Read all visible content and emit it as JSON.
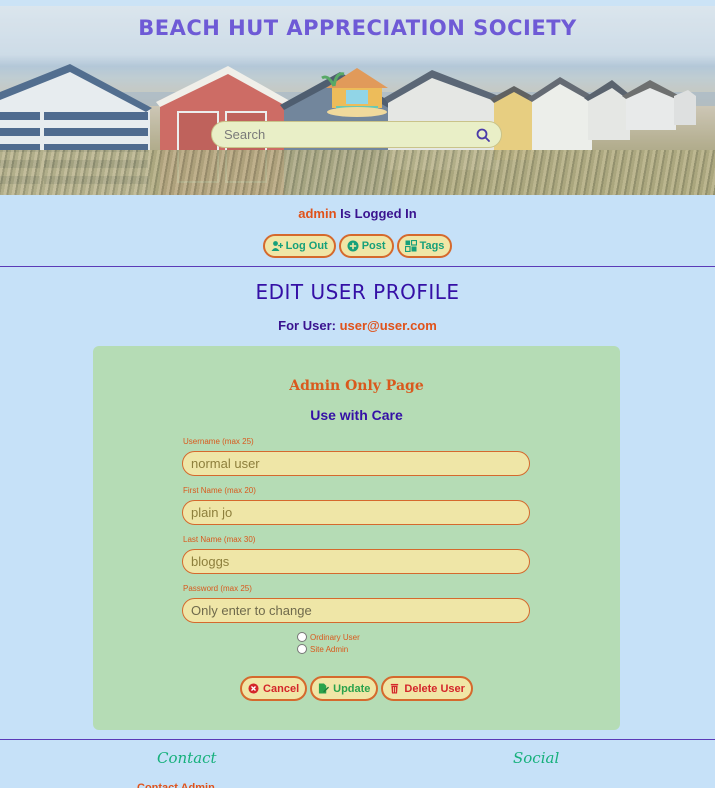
{
  "site": {
    "title": "BEACH HUT APPRECIATION SOCIETY",
    "search_placeholder": "Search"
  },
  "session": {
    "username": "admin",
    "status_text": " Is Logged In"
  },
  "nav": {
    "logout_label": "Log Out",
    "post_label": "Post",
    "tags_label": "Tags"
  },
  "page": {
    "title": "EDIT USER PROFILE",
    "for_user_label": "For User: ",
    "for_user_email": "user@user.com"
  },
  "form": {
    "admin_notice": "Admin Only Page",
    "caution": "Use with Care",
    "username_label": "Username (max 25)",
    "username_value": "normal user",
    "firstname_label": "First Name (max 20)",
    "firstname_value": "plain jo",
    "lastname_label": "Last Name (max 30)",
    "lastname_value": "bloggs",
    "password_label": "Password (max 25)",
    "password_placeholder": "Only enter to change",
    "role_ordinary": "Ordinary User",
    "role_admin": "Site Admin",
    "cancel_label": "Cancel",
    "update_label": "Update",
    "delete_label": "Delete User"
  },
  "footer": {
    "contact_heading": "Contact",
    "social_heading": "Social",
    "contact_peek": "Contact Admin"
  },
  "colors": {
    "page_bg": "#c6e1f8",
    "card_bg": "#b5dcb5",
    "accent_orange": "#d9591d",
    "accent_purple": "#3510a6",
    "accent_green": "#16a07a",
    "field_bg": "#efe6a7"
  },
  "icons": {
    "search": "search-icon",
    "logout": "user-plus-icon",
    "post": "plus-circle-icon",
    "tags": "tags-icon",
    "cancel": "x-circle-icon",
    "update": "edit-file-icon",
    "delete": "trash-icon"
  }
}
